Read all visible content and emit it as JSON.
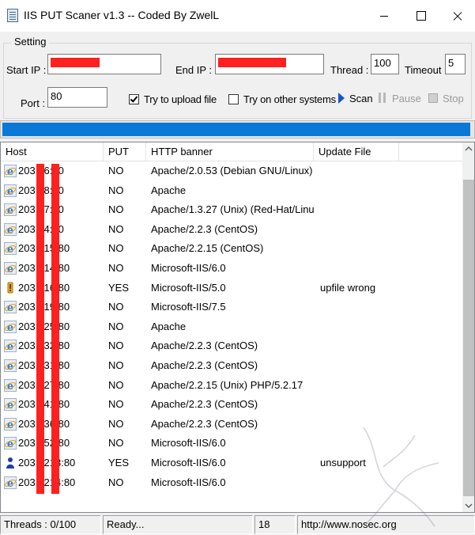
{
  "window": {
    "title": "IIS PUT Scaner v1.3 -- Coded By ZwelL"
  },
  "setting": {
    "legend": "Setting",
    "start_ip_label": "Start IP :",
    "end_ip_label": "End IP :",
    "thread_label": "Thread :",
    "thread_value": "100",
    "timeout_label": "Timeout :",
    "timeout_value": "5",
    "port_label": "Port :",
    "port_value": "80",
    "try_upload_label": "Try to upload file",
    "try_upload_checked": true,
    "try_other_label": "Try on other systems",
    "try_other_checked": false,
    "scan_label": "Scan",
    "pause_label": "Pause",
    "stop_label": "Stop"
  },
  "progress": {
    "fraction": 0.995
  },
  "list": {
    "columns": [
      "Host",
      "PUT",
      "HTTP banner",
      "Update File"
    ],
    "rows": [
      {
        "host": "203.     .6:80",
        "put": "NO",
        "banner": "Apache/2.0.53 (Debian GNU/Linux) ...",
        "update": "",
        "icon": "ie-icon"
      },
      {
        "host": "203.     .8:80",
        "put": "NO",
        "banner": "Apache",
        "update": "",
        "icon": "ie-icon"
      },
      {
        "host": "203.     .7:80",
        "put": "NO",
        "banner": "Apache/1.3.27 (Unix)  (Red-Hat/Linu...",
        "update": "",
        "icon": "ie-icon"
      },
      {
        "host": "203.     .4:80",
        "put": "NO",
        "banner": "Apache/2.2.3 (CentOS)",
        "update": "",
        "icon": "ie-icon"
      },
      {
        "host": "203.     .15:80",
        "put": "NO",
        "banner": "Apache/2.2.15 (CentOS)",
        "update": "",
        "icon": "ie-icon"
      },
      {
        "host": "203.     .14:80",
        "put": "NO",
        "banner": "Microsoft-IIS/6.0",
        "update": "",
        "icon": "ie-icon"
      },
      {
        "host": "203.     .16:80",
        "put": "YES",
        "banner": "Microsoft-IIS/5.0",
        "update": "upfile wrong",
        "icon": "warning-icon"
      },
      {
        "host": "203.     .19:80",
        "put": "NO",
        "banner": "Microsoft-IIS/7.5",
        "update": "",
        "icon": "ie-icon"
      },
      {
        "host": "203.     .25:80",
        "put": "NO",
        "banner": "Apache",
        "update": "",
        "icon": "ie-icon"
      },
      {
        "host": "203.     .32:80",
        "put": "NO",
        "banner": "Apache/2.2.3 (CentOS)",
        "update": "",
        "icon": "ie-icon"
      },
      {
        "host": "203.     .31:80",
        "put": "NO",
        "banner": "Apache/2.2.3 (CentOS)",
        "update": "",
        "icon": "ie-icon"
      },
      {
        "host": "203.     .27:80",
        "put": "NO",
        "banner": "Apache/2.2.15 (Unix) PHP/5.2.17",
        "update": "",
        "icon": "ie-icon"
      },
      {
        "host": "203.     .41:80",
        "put": "NO",
        "banner": "Apache/2.2.3 (CentOS)",
        "update": "",
        "icon": "ie-icon"
      },
      {
        "host": "203.     .36:80",
        "put": "NO",
        "banner": "Apache/2.2.3 (CentOS)",
        "update": "",
        "icon": "ie-icon"
      },
      {
        "host": "203.     .52:80",
        "put": "NO",
        "banner": "Microsoft-IIS/6.0",
        "update": "",
        "icon": "ie-icon"
      },
      {
        "host": "203.     .213:80",
        "put": "YES",
        "banner": "Microsoft-IIS/6.0",
        "update": "unsupport",
        "icon": "user-icon"
      },
      {
        "host": "203.     .214:80",
        "put": "NO",
        "banner": "Microsoft-IIS/6.0",
        "update": "",
        "icon": "ie-icon"
      }
    ]
  },
  "status": {
    "threads": "Threads : 0/100",
    "state": "Ready...",
    "count": "18",
    "url": "http://www.nosec.org"
  },
  "colors": {
    "progress": "#0a78d7",
    "redaction": "#ff2020"
  }
}
